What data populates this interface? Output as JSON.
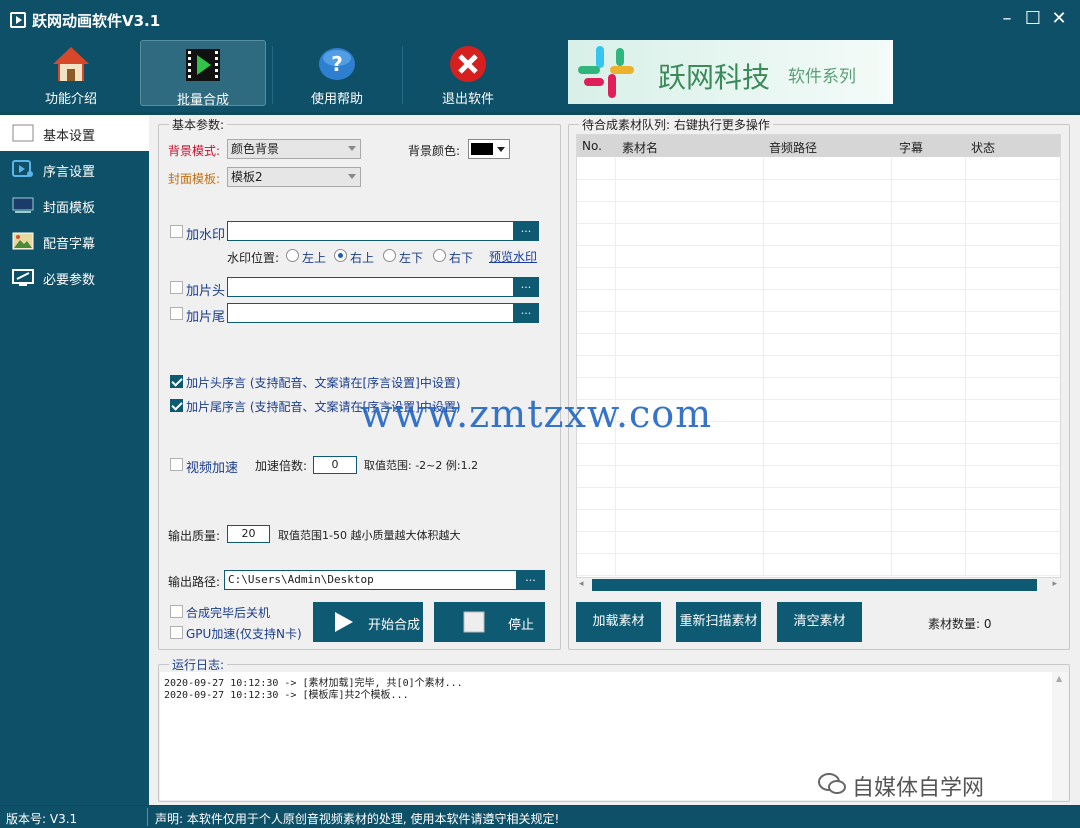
{
  "titlebar": {
    "title": "跃网动画软件V3.1",
    "min_icon": "minimize-icon",
    "max_icon": "maximize-icon",
    "close_icon": "close-icon"
  },
  "toolbar": {
    "items": [
      {
        "label": "功能介绍",
        "icon": "home-icon"
      },
      {
        "label": "批量合成",
        "icon": "film-play-icon",
        "active": true
      },
      {
        "label": "使用帮助",
        "icon": "help-icon"
      },
      {
        "label": "退出软件",
        "icon": "exit-icon"
      }
    ],
    "banner": {
      "brand": "跃网科技",
      "sub": "软件系列"
    }
  },
  "sidebar": {
    "items": [
      {
        "label": "基本设置",
        "icon": "settings-panel-icon",
        "active": true
      },
      {
        "label": "序言设置",
        "icon": "preface-icon"
      },
      {
        "label": "封面模板",
        "icon": "cover-icon"
      },
      {
        "label": "配音字幕",
        "icon": "subtitle-icon"
      },
      {
        "label": "必要参数",
        "icon": "params-icon"
      }
    ]
  },
  "basic": {
    "legend": "基本参数:",
    "bg_mode_label": "背景模式:",
    "bg_mode_value": "颜色背景",
    "bg_color_label": "背景颜色:",
    "bg_color_value": "#000000",
    "cover_label": "封面模板:",
    "cover_value": "模板2",
    "watermark_label": "加水印",
    "watermark_path": "",
    "watermark_pos_label": "水印位置:",
    "positions": [
      "左上",
      "右上",
      "左下",
      "右下"
    ],
    "position_selected": 1,
    "preview_link": "预览水印",
    "head_label": "加片头",
    "tail_label": "加片尾",
    "browse": "...",
    "head_preface": "加片头序言 (支持配音、文案请在[序言设置]中设置)",
    "tail_preface": "加片尾序言 (支持配音、文案请在[序言设置]中设置)",
    "speed_label": "视频加速",
    "speed_factor_label": "加速倍数:",
    "speed_value": "0",
    "speed_range": "取值范围: -2~2 例:1.2",
    "quality_label": "输出质量:",
    "quality_value": "20",
    "quality_range": "取值范围1-50 越小质量越大体积越大",
    "output_label": "输出路径:",
    "output_value": "C:\\Users\\Admin\\Desktop",
    "shutdown_label": "合成完毕后关机",
    "gpu_label": "GPU加速(仅支持N卡)",
    "start_label": "开始合成",
    "stop_label": "停止"
  },
  "queue": {
    "legend": "待合成素材队列: 右键执行更多操作",
    "columns": [
      "No.",
      "素材名",
      "音频路径",
      "字幕",
      "状态"
    ],
    "rows": [],
    "load_btn": "加载素材",
    "rescan_btn": "重新扫描素材",
    "clear_btn": "清空素材",
    "count_label": "素材数量: 0"
  },
  "log": {
    "legend": "运行日志:",
    "lines": [
      "2020-09-27 10:12:30 -> [素材加载]完毕, 共[0]个素材...",
      "2020-09-27 10:12:30 -> [模板库]共2个模板..."
    ]
  },
  "status": {
    "version": "版本号: V3.1",
    "notice": "声明: 本软件仅用于个人原创音视频素材的处理, 使用本软件请遵守相关规定!"
  },
  "overlay": {
    "watermark": "www.zmtzxw.com",
    "wechat_mark": "自媒体自学网"
  }
}
